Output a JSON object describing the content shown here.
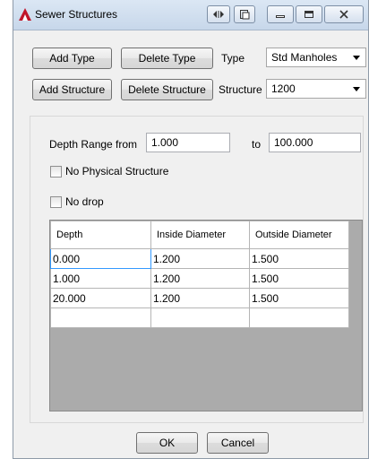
{
  "window": {
    "title": "Sewer Structures"
  },
  "toolbar": {
    "add_type_label": "Add Type",
    "delete_type_label": "Delete Type",
    "type_label": "Type",
    "type_value": "Std Manholes",
    "add_structure_label": "Add Structure",
    "delete_structure_label": "Delete Structure",
    "structure_label": "Structure",
    "structure_value": "1200"
  },
  "depth_range": {
    "from_label": "Depth Range from",
    "from_value": "1.000",
    "to_label": "to",
    "to_value": "100.000"
  },
  "options": {
    "no_physical_structure_label": "No Physical Structure",
    "no_physical_structure_checked": false,
    "no_drop_label": "No drop",
    "no_drop_checked": false
  },
  "grid": {
    "columns": [
      "Depth",
      "Inside Diameter",
      "Outside Diameter"
    ],
    "rows": [
      [
        "0.000",
        "1.200",
        "1.500"
      ],
      [
        "1.000",
        "1.200",
        "1.500"
      ],
      [
        "20.000",
        "1.200",
        "1.500"
      ],
      [
        "",
        "",
        ""
      ]
    ]
  },
  "footer": {
    "ok_label": "OK",
    "cancel_label": "Cancel"
  },
  "icons": {
    "app": "autocad-logo-icon",
    "titlebar": [
      "left-right-arrows-icon",
      "restore-down-icon",
      "minimize-icon",
      "maximize-icon",
      "close-icon"
    ]
  },
  "colors": {
    "selection_border": "#3399ff",
    "grid_background": "#ababab"
  }
}
